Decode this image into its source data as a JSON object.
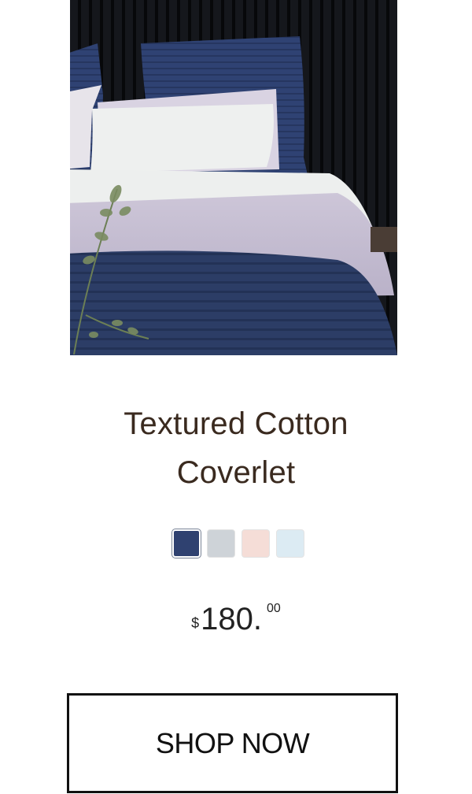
{
  "product": {
    "image_alt": "Textured Cotton Coverlet on a bed",
    "title_line1": "Textured Cotton",
    "title_line2": "Coverlet",
    "swatches": [
      {
        "name": "navy",
        "color": "#2f4170",
        "selected": true
      },
      {
        "name": "grey",
        "color": "#ced3d8",
        "selected": false
      },
      {
        "name": "blush",
        "color": "#f5ddd7",
        "selected": false
      },
      {
        "name": "light blue",
        "color": "#dcebf3",
        "selected": false
      }
    ],
    "price": {
      "currency": "$",
      "dollars": "180.",
      "cents": "00"
    }
  },
  "cta": {
    "label": "SHOP NOW"
  }
}
